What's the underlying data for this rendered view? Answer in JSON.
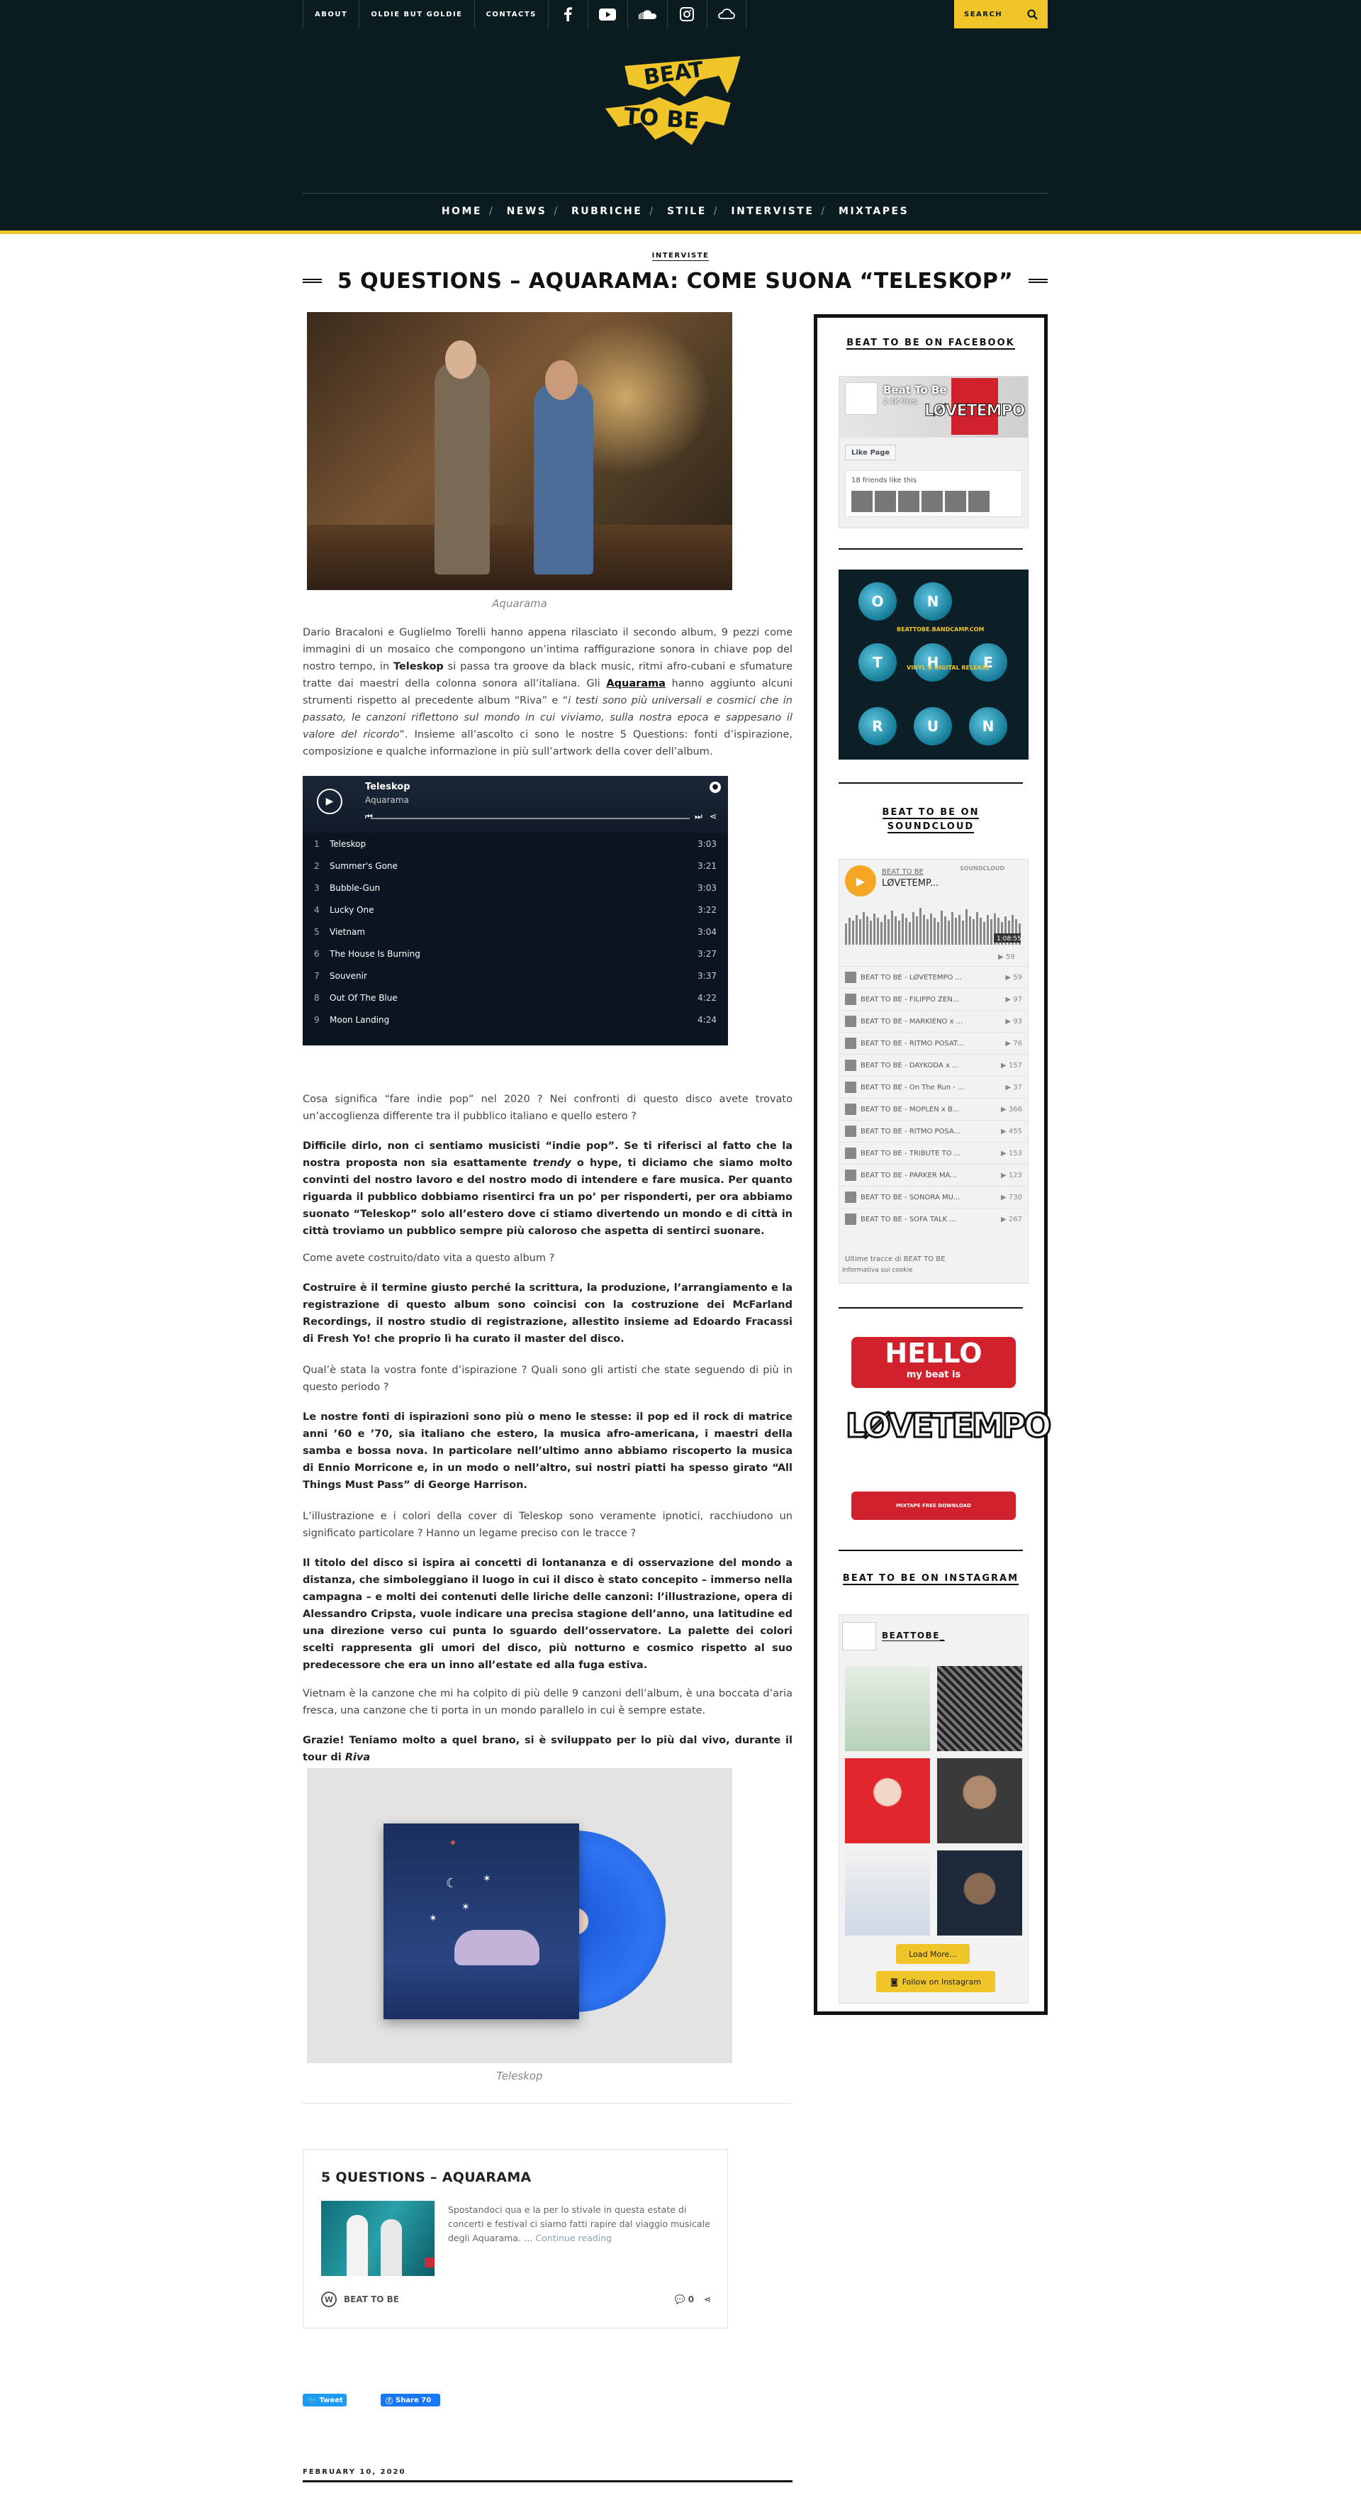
{
  "topbar": {
    "links": [
      "ABOUT",
      "OLDIE BUT GOLDIE",
      "CONTACTS"
    ],
    "social_icons": [
      "facebook-icon",
      "youtube-icon",
      "soundcloud-icon",
      "instagram-icon",
      "mixcloud-icon"
    ],
    "search_label": "SEARCH"
  },
  "logo": {
    "text_line1": "BEAT",
    "text_line2": "TO BE"
  },
  "nav": {
    "items": [
      "HOME",
      "NEWS",
      "RUBRICHE",
      "STILE",
      "INTERVISTE",
      "MIXTAPES"
    ],
    "separator": "/"
  },
  "article": {
    "category": "INTERVISTE",
    "title": "5 QUESTIONS – AQUARAMA: COME SUONA “TELESKOP”",
    "hero_caption": "Aquarama",
    "intro_part1": "Dario Bracaloni e Guglielmo Torelli hanno appena rilasciato il secondo album, 9 pezzi come immagini di un mosaico che compongono un’intima raffigurazione sonora in chiave pop del nostro tempo, in ",
    "intro_bold1": "Teleskop",
    "intro_part2": " si passa tra groove da black music, ritmi afro-cubani e sfumature tratte dai maestri della colonna sonora all’italiana. Gli ",
    "intro_link": "Aquarama",
    "intro_part3": " hanno aggiunto alcuni strumenti rispetto al precedente album “Riva” e “",
    "intro_italic": "i testi sono più universali e cosmici che in passato, le canzoni riflettono sul mondo in cui viviamo, sulla nostra epoca e sappesano il valore del ricordo",
    "intro_part4": "”. Insieme all’ascolto ci sono le nostre 5 Questions: fonti d’ispirazione, composizione e qualche informazione in più sull’artwork della cover dell’album.",
    "q1": "Cosa significa “fare indie pop” nel 2020 ? Nei confronti di questo disco avete trovato un’accoglienza differente tra il pubblico italiano e quello estero ?",
    "a1_part1": "Difficile dirlo, non ci sentiamo musicisti “indie pop”. Se ti riferisci al fatto che la nostra proposta non sia esattamente ",
    "a1_italic": "trendy",
    "a1_part2": " o hype, ti diciamo che siamo molto convinti del nostro lavoro e del nostro modo di intendere e fare musica. Per quanto riguarda il pubblico dobbiamo risentirci fra un po’ per risponderti, per ora abbiamo suonato “Teleskop” solo all’estero dove ci stiamo divertendo un mondo e di città in città troviamo un pubblico sempre più caloroso che aspetta di sentirci suonare.",
    "q2": "Come avete costruito/dato vita a questo album ?",
    "a2": "Costruire è il termine giusto perché la scrittura, la produzione, l’arrangiamento e la registrazione di questo album sono coincisi con la costruzione dei McFarland Recordings, il nostro studio di registrazione, allestito insieme ad Edoardo Fracassi di Fresh Yo! che proprio lì ha curato il master del disco.",
    "q3": "Qual’è stata la vostra fonte d’ispirazione ? Quali sono gli artisti che state seguendo di più in questo periodo ?",
    "a3": "Le nostre fonti di ispirazioni sono più o meno le stesse: il pop ed il rock di matrice anni ’60 e ’70, sia italiano che estero, la musica afro-americana, i maestri della samba e bossa nova. In particolare nell’ultimo anno abbiamo riscoperto la musica di Ennio Morricone e, in un modo o nell’altro, sui nostri piatti ha spesso girato “All Things Must Pass” di George Harrison.",
    "q4": "L’illustrazione e i colori della cover di Teleskop sono veramente ipnotici, racchiudono un significato particolare ? Hanno un legame preciso con le tracce ?",
    "a4": "Il titolo del disco si ispira ai concetti di lontananza e di osservazione del mondo a distanza, che simboleggiano il luogo in cui il disco è stato concepito – immerso nella campagna – e molti dei contenuti delle liriche delle canzoni: l’illustrazione, opera di Alessandro Cripsta, vuole indicare una precisa stagione dell’anno, una latitudine ed una direzione verso cui punta lo sguardo dell’osservatore. La palette dei colori scelti rappresenta gli umori del disco, più notturno e cosmico rispetto al suo predecessore che era un inno all’estate ed alla fuga estiva.",
    "q5": "Vietnam è la canzone che mi ha colpito di più delle 9 canzoni dell’album, è una boccata d’aria fresca, una canzone che ti porta in un mondo parallelo in cui è sempre estate.",
    "a5_part1": "Grazie! Teniamo molto a quel brano, si è sviluppato per lo più dal vivo, durante il tour di ",
    "a5_italic": "Riva",
    "album_caption": "Teleskop",
    "date": "FEBRUARY 10, 2020"
  },
  "player": {
    "title": "Teleskop",
    "artist": "Aquarama",
    "tracks": [
      {
        "n": "1",
        "title": "Teleskop",
        "dur": "3:03"
      },
      {
        "n": "2",
        "title": "Summer's Gone",
        "dur": "3:21"
      },
      {
        "n": "3",
        "title": "Bubble-Gun",
        "dur": "3:03"
      },
      {
        "n": "4",
        "title": "Lucky One",
        "dur": "3:22"
      },
      {
        "n": "5",
        "title": "Vietnam",
        "dur": "3:04"
      },
      {
        "n": "6",
        "title": "The House Is Burning",
        "dur": "3:27"
      },
      {
        "n": "7",
        "title": "Souvenir",
        "dur": "3:37"
      },
      {
        "n": "8",
        "title": "Out Of The Blue",
        "dur": "4:22"
      },
      {
        "n": "9",
        "title": "Moon Landing",
        "dur": "4:24"
      }
    ]
  },
  "embed": {
    "title": "5 QUESTIONS – AQUARAMA",
    "excerpt": " Spostandoci qua e la per lo stivale in questa estate di concerti e festival ci siamo fatti rapire dal viaggio musicale degli Aquarama. …",
    "more": "Continue reading",
    "site": "BEAT TO BE",
    "comments": "0"
  },
  "share": {
    "tweet": "Tweet",
    "fb": "Share 70"
  },
  "sidebar": {
    "fb_title": "BEAT TO BE ON FACEBOOK",
    "fb_name": "Beat To Be",
    "fb_likes": "2.4K likes",
    "fb_like_btn": "Like Page",
    "fb_friends": "18 friends like this",
    "otr_letters": [
      "O",
      "N",
      "T",
      "H",
      "E",
      "R",
      "U",
      "N"
    ],
    "otr_site": "BEATTOBE.BANDCAMP.COM",
    "otr_release": "VINYL & DIGITAL RELEASE",
    "sc_title_1": "BEAT TO BE ON",
    "sc_title_2": "SOUNDCLOUD",
    "sc_user": "BEAT TO BE",
    "sc_track": "LØVETEMP...",
    "sc_logo": "SOUNDCLOUD",
    "sc_time": "1:08:55",
    "sc_plays": "59",
    "sc_list": [
      {
        "t": "BEAT TO BE - LØVETEMPO ...",
        "c": "59"
      },
      {
        "t": "BEAT TO BE - FILIPPO ZEN...",
        "c": "97"
      },
      {
        "t": "BEAT TO BE - MARKIENO x ...",
        "c": "93"
      },
      {
        "t": "BEAT TO BE - RITMO POSAT...",
        "c": "76"
      },
      {
        "t": "BEAT TO BE - DAYKODA x ...",
        "c": "157"
      },
      {
        "t": "BEAT TO BE - On The Run - ...",
        "c": "37"
      },
      {
        "t": "BEAT TO BE - MOPLEN x B...",
        "c": "366"
      },
      {
        "t": "BEAT TO BE - RITMO POSA...",
        "c": "455"
      },
      {
        "t": "BEAT TO BE - TRIBUTE TO ...",
        "c": "153"
      },
      {
        "t": "BEAT TO BE - PARKER MA...",
        "c": "123"
      },
      {
        "t": "BEAT TO BE - SONORA MU...",
        "c": "730"
      },
      {
        "t": "BEAT TO BE - SOFA TALK ...",
        "c": "267"
      }
    ],
    "sc_footer": "Ultime tracce di BEAT TO BE",
    "sc_cookie": "Informativa sui cookie",
    "ad_hello": "HELLO",
    "ad_sub": "my beat is",
    "ad_lovetempo": "LØVETEMPO",
    "ad_download": "MIXTAPE FREE DOWNLOAD",
    "ig_title": "BEAT TO BE ON INSTAGRAM",
    "ig_user": "BEATTOBE_",
    "ig_load": "Load More...",
    "ig_follow": "Follow on Instagram"
  },
  "colors": {
    "header_bg": "#0a1c20",
    "accent": "#f0c52a",
    "player_bg": "#0b1522"
  }
}
